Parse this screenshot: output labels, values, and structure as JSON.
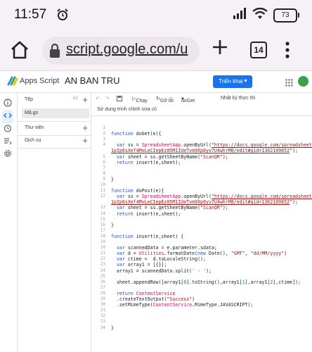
{
  "status_bar": {
    "time": "11:57",
    "battery": "73"
  },
  "browser": {
    "url": "script.google.com/u",
    "tab_count": "14"
  },
  "header": {
    "app_name": "Apps Script",
    "project_name": "AN BAN TRU",
    "deploy_label": "Triển khai"
  },
  "files_panel": {
    "files_title": "Tệp",
    "sort_label": "AZ",
    "active_file": "Mã.gs",
    "libraries_title": "Thư viện",
    "services_title": "Dịch vụ"
  },
  "toolbar": {
    "run_label": "Chạy",
    "debug_label": "Gỡ lỗi",
    "function_name": "doGet",
    "log_label": "Nhật ký thực thi",
    "history_hint": "Sử dụng trình chỉnh sửa cũ"
  },
  "code_lines": [
    {
      "n": "1",
      "t": ""
    },
    {
      "n": "2",
      "t": "function doGet(e){"
    },
    {
      "n": "3",
      "t": ""
    },
    {
      "n": "4",
      "t": "  var ss = SpreadsheetApp.openByUrl(\"https://docs.google.com/spreadsheets/d/"
    },
    {
      "n": "",
      "t": "1pIp6sXef4MvLeCIepEz05M1IUeTvm9Xp0yv7U4whrM8/edit#gid=1362109852\");"
    },
    {
      "n": "5",
      "t": "  var sheet = ss.getSheetByName(\"ScanQR\");"
    },
    {
      "n": "6",
      "t": "  return insert(e,sheet);"
    },
    {
      "n": "7",
      "t": ""
    },
    {
      "n": "8",
      "t": ""
    },
    {
      "n": "9",
      "t": "}"
    },
    {
      "n": "10",
      "t": ""
    },
    {
      "n": "11",
      "t": "function doPost(e){"
    },
    {
      "n": "12",
      "t": "  var ss = SpreadsheetApp.openByUrl(\"https://docs.google.com/spreadsheets/d/"
    },
    {
      "n": "",
      "t": "1pIp6sXef4MvLeCIepEz05M1IUeTvm9Xp0yv7U4whrM8/edit#gid=1362109852\");"
    },
    {
      "n": "13",
      "t": "  var sheet = ss.getSheetByName(\"ScanQR\");"
    },
    {
      "n": "14",
      "t": "  return insert(e,sheet);"
    },
    {
      "n": "15",
      "t": ""
    },
    {
      "n": "16",
      "t": "}"
    },
    {
      "n": "17",
      "t": ""
    },
    {
      "n": "18",
      "t": "function insert(e,sheet) {"
    },
    {
      "n": "19",
      "t": ""
    },
    {
      "n": "20",
      "t": "  var scannedData = e.parameter.sdata;"
    },
    {
      "n": "21",
      "t": "  var d = Utilities.formatDate(new Date(), \"GMT\", \"dd/MM/yyyy\")"
    },
    {
      "n": "22",
      "t": "  var ctime =  d.toLocaleString();"
    },
    {
      "n": "23",
      "t": "  var array1 = [{}];"
    },
    {
      "n": "24",
      "t": "  array1 = scannedData.split(' - ');"
    },
    {
      "n": "25",
      "t": ""
    },
    {
      "n": "26",
      "t": "  sheet.appendRow([array1[0].toString(),array1[1],array1[2],ctime]);"
    },
    {
      "n": "27",
      "t": ""
    },
    {
      "n": "28",
      "t": "  return ContentService"
    },
    {
      "n": "29",
      "t": "  .createTextOutput(\"Success\")"
    },
    {
      "n": "30",
      "t": "  .setMimeType(ContentService.MimeType.JAVASCRIPT);"
    },
    {
      "n": "31",
      "t": ""
    },
    {
      "n": "32",
      "t": ""
    },
    {
      "n": "33",
      "t": ""
    },
    {
      "n": "34",
      "t": "}"
    }
  ],
  "colors": {
    "accent": "#1a73e8",
    "string": "#a31515",
    "keyword": "#1a4fd0"
  }
}
